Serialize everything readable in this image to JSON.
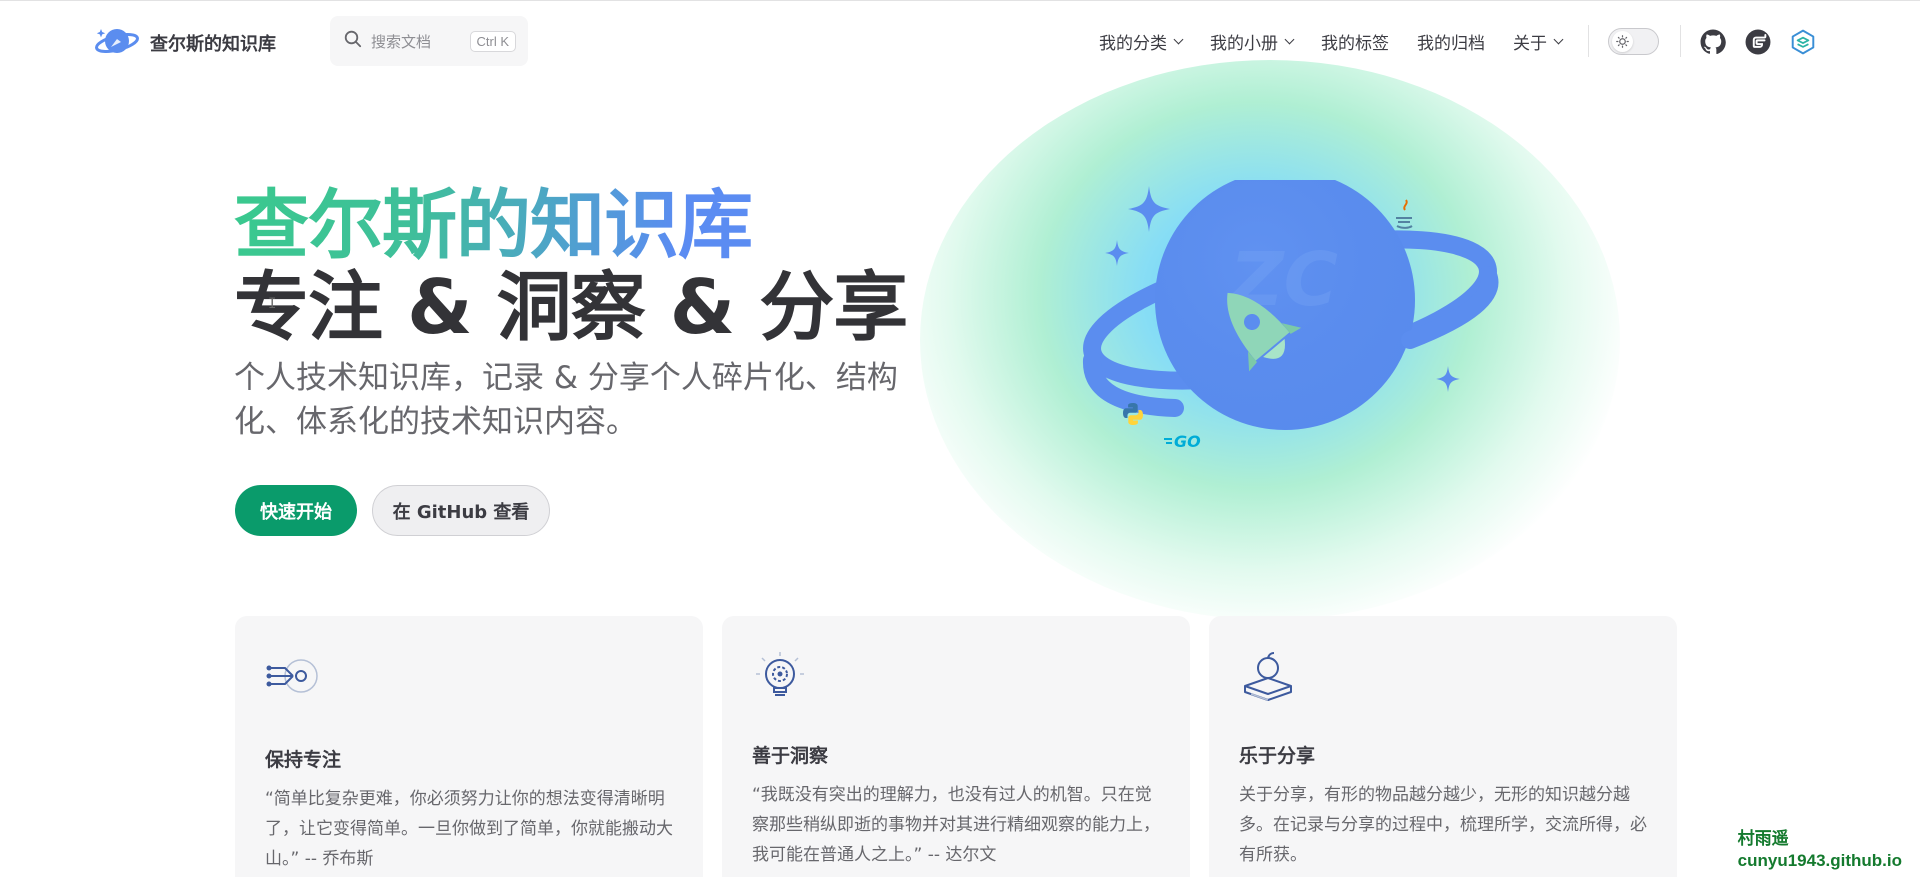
{
  "nav": {
    "brand_title": "查尔斯的知识库",
    "search_placeholder": "搜索文档",
    "search_shortcut": "Ctrl K",
    "menu": [
      {
        "label": "我的分类",
        "has_dropdown": true
      },
      {
        "label": "我的小册",
        "has_dropdown": true
      },
      {
        "label": "我的标签",
        "has_dropdown": false
      },
      {
        "label": "我的归档",
        "has_dropdown": false
      },
      {
        "label": "关于",
        "has_dropdown": true
      }
    ],
    "theme_toggle_icon": "sun-icon",
    "social": [
      "github-icon",
      "gitee-icon",
      "blog-icon"
    ]
  },
  "hero": {
    "name": "查尔斯的知识库",
    "text": "专注 & 洞察 & 分享",
    "tagline": "个人技术知识库，记录 & 分享个人碎片化、结构化、体系化的技术知识内容。",
    "actions": [
      {
        "label": "快速开始",
        "theme": "brand"
      },
      {
        "label": "在 GitHub 查看",
        "theme": "alt"
      }
    ],
    "image_text": "ZC"
  },
  "features": [
    {
      "icon": "focus-icon",
      "title": "保持专注",
      "details": "“简单比复杂更难，你必须努力让你的想法变得清晰明了，让它变得简单。一旦你做到了简单，你就能搬动大山。” -- 乔布斯"
    },
    {
      "icon": "lightbulb-gear-icon",
      "title": "善于洞察",
      "details": "“我既没有突出的理解力，也没有过人的机智。只在觉察那些稍纵即逝的事物并对其进行精细观察的能力上，我可能在普通人之上。” -- 达尔文"
    },
    {
      "icon": "apple-books-icon",
      "title": "乐于分享",
      "details": "关于分享，有形的物品越分越少，无形的知识越分越多。在记录与分享的过程中，梳理所学，交流所得，必有所获。"
    }
  ],
  "watermark": {
    "name": "村雨遥",
    "site": "cunyu1943.github.io"
  },
  "colors": {
    "brand": "#0a9b6b",
    "gradient_start": "#3ac98e",
    "gradient_end": "#5b8cf2",
    "planet": "#5b8def"
  }
}
